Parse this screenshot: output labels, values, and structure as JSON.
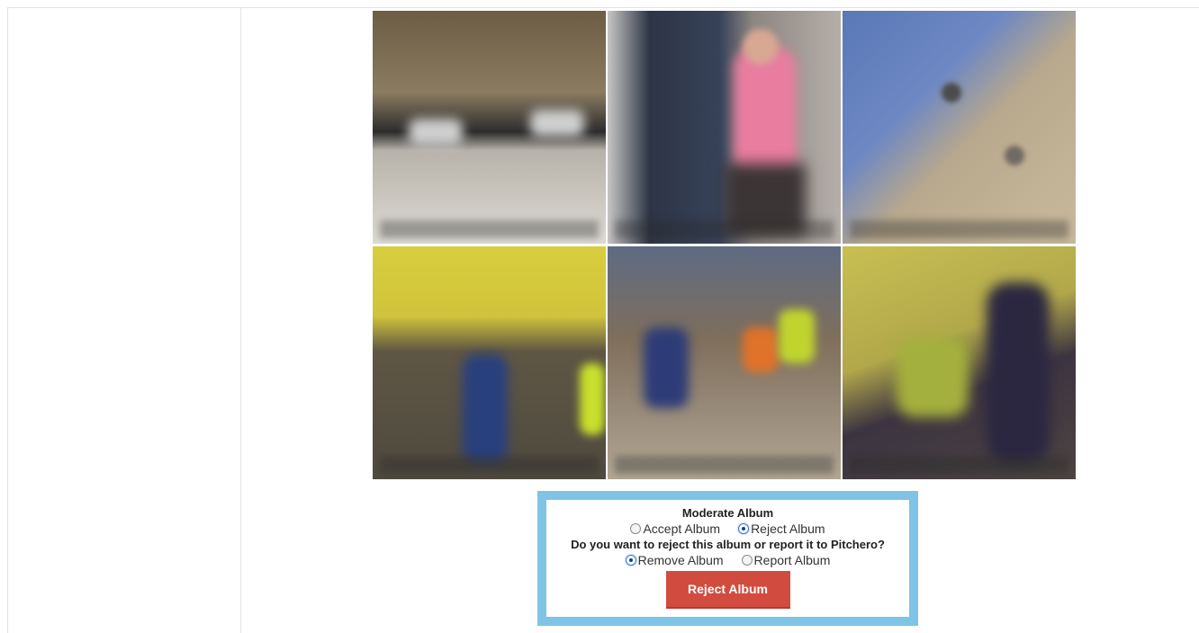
{
  "moderation": {
    "title": "Moderate Album",
    "options": [
      {
        "label": "Accept Album",
        "selected": false
      },
      {
        "label": "Reject Album",
        "selected": true
      }
    ],
    "question": "Do you want to reject this album or report it to Pitchero?",
    "reject_options": [
      {
        "label": "Remove Album",
        "selected": true
      },
      {
        "label": "Report Album",
        "selected": false
      }
    ],
    "submit_label": "Reject Album",
    "accent_color": "#7fc3e5",
    "button_color": "#d24b3f"
  },
  "album": {
    "photo_count_visible": 6
  }
}
